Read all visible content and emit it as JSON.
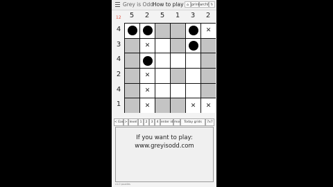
{
  "topbar": {
    "app_title": "Grey is Odd",
    "howto_link": "How to play",
    "home_icon": "home-icon",
    "print_label": "print",
    "archive_label": "archive",
    "refresh_icon": "refresh-icon"
  },
  "puzzle": {
    "counter": "12",
    "col_clues": [
      "5",
      "2",
      "5",
      "1",
      "3",
      "2"
    ],
    "row_clues": [
      "4",
      "3",
      "4",
      "2",
      "4",
      "1"
    ],
    "cell_states": [
      [
        "white",
        "white",
        "grey",
        "grey",
        "white",
        "white"
      ],
      [
        "grey",
        "white",
        "white",
        "grey",
        "white",
        "grey"
      ],
      [
        "grey",
        "white",
        "white",
        "white",
        "white",
        "grey"
      ],
      [
        "grey",
        "white",
        "white",
        "grey",
        "white",
        "grey"
      ],
      [
        "grey",
        "white",
        "white",
        "white",
        "white",
        "grey"
      ],
      [
        "grey",
        "white",
        "grey",
        "grey",
        "white",
        "white"
      ]
    ],
    "dots": [
      [
        0,
        0
      ],
      [
        0,
        1
      ],
      [
        0,
        4
      ],
      [
        1,
        4
      ],
      [
        2,
        1
      ]
    ],
    "crosses": [
      [
        0,
        5
      ],
      [
        1,
        1
      ],
      [
        3,
        1
      ],
      [
        4,
        1
      ],
      [
        5,
        1
      ],
      [
        5,
        4
      ],
      [
        5,
        5
      ]
    ],
    "colors": {
      "grey": "#c4c4c4",
      "white": "#ffffff",
      "dot": "#000000",
      "counter": "#e2513e"
    }
  },
  "nav": {
    "prev_label": "< Easy",
    "next_label": ">",
    "level_label": "level",
    "level_buttons": [
      "1",
      "2",
      "3",
      "4"
    ],
    "enter_id_label": "enter id",
    "mod_label": "mod",
    "today_label": "Today grids",
    "size_label": "7x7"
  },
  "info": {
    "line1": "If you want to play:",
    "line2": "www.greyisodd.com"
  },
  "footer": {
    "text": "v1.0 puzzles"
  }
}
